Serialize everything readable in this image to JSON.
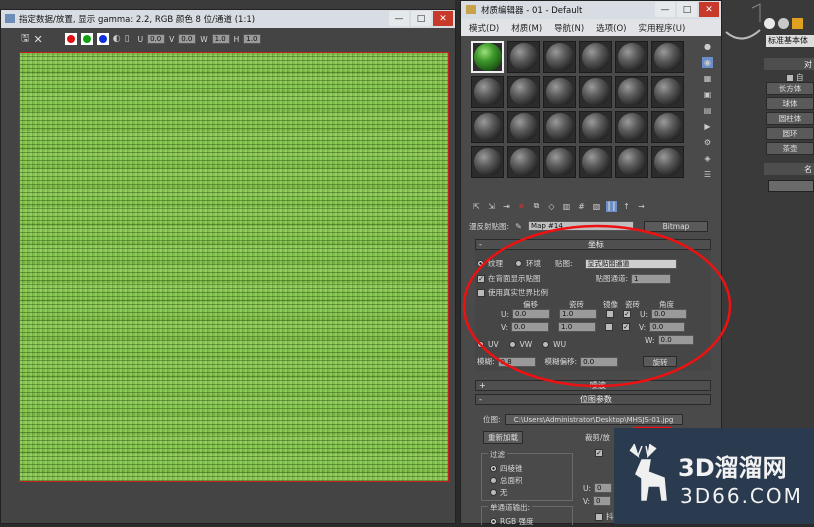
{
  "texture_window": {
    "title": "指定数据/放置, 显示 gamma: 2.2, RGB 颜色 8 位/通道 (1:1)",
    "fields": {
      "u": "0.0",
      "v": "0.0",
      "w": "1.0",
      "h": "1.0"
    },
    "labels": {
      "u": "U",
      "v": "V",
      "w": "W",
      "h": "H"
    }
  },
  "mat_editor": {
    "title": "材质编辑器 - 01 - Default",
    "menu": [
      "模式(D)",
      "材质(M)",
      "导航(N)",
      "选项(O)",
      "实用程序(U)"
    ],
    "map_row_label": "漫反射贴图:",
    "map_name": "Map #14",
    "map_type": "Bitmap",
    "coords": {
      "header": "坐标",
      "radio_texture": "纹理",
      "radio_env": "环境",
      "mapping_label": "贴图:",
      "mapping_value": "显式贴图通道",
      "chk_back": "在背面显示贴图",
      "map_channel_label": "贴图通道:",
      "map_channel_value": "1",
      "chk_real": "使用真实世界比例",
      "col_offset": "偏移",
      "col_tiling": "瓷砖",
      "col_mirror": "镜像",
      "col_tile": "瓷砖",
      "col_angle": "角度",
      "u": "U:",
      "v": "V:",
      "w": "W:",
      "u_off": "0.0",
      "v_off": "0.0",
      "u_tile": "1.0",
      "v_tile": "1.0",
      "u_ang": "0.0",
      "v_ang": "0.0",
      "w_ang": "0.0",
      "uv": "UV",
      "vw": "VW",
      "wu": "WU",
      "blur": "模糊:",
      "blur_val": "0.8",
      "blur_off": "模糊偏移:",
      "blur_off_val": "0.0",
      "rotate": "旋转"
    },
    "noise": {
      "header": "噪波"
    },
    "bitmap": {
      "header": "位图参数",
      "bitmap_label": "位图:",
      "path": "C:\\Users\\Administrator\\Desktop\\MHSJS-01.jpg",
      "reload": "重新加载",
      "crop": "裁剪/放",
      "filter": "过滤",
      "f1": "四棱锥",
      "f2": "总面积",
      "f3": "无",
      "u": "U:",
      "v": "V:",
      "u_val": "0",
      "v_val": "0",
      "output": "单通道输出:",
      "rgb": "RGB 强度",
      "jitter": "抖动"
    }
  },
  "cmd_panel": {
    "dropdown": "标准基本体",
    "obj_type_header": "对",
    "autogrid": "自",
    "buttons": [
      "长方体",
      "球体",
      "圆柱体",
      "圆环",
      "茶壶"
    ],
    "name_header": "名"
  },
  "watermark": {
    "brand": "3D溜溜网",
    "url": "3D66.COM"
  }
}
